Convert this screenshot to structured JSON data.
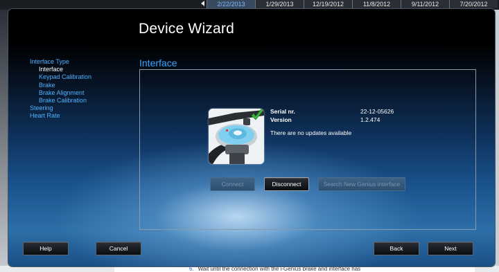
{
  "background": {
    "date_tabs": [
      "2/22/2013",
      "1/29/2013",
      "12/19/2012",
      "11/8/2012",
      "9/11/2012",
      "7/20/2012"
    ],
    "doc_bullet": "6.",
    "doc_text": "Wait until the connection with the i-Genius brake and interface has"
  },
  "dialog": {
    "title": "Device Wizard",
    "nav": [
      {
        "label": "Interface Type",
        "level": 0,
        "active": false
      },
      {
        "label": "Interface",
        "level": 1,
        "active": true
      },
      {
        "label": "Keypad Calibration",
        "level": 1,
        "active": false
      },
      {
        "label": "Brake",
        "level": 1,
        "active": false
      },
      {
        "label": "Brake Alignment",
        "level": 1,
        "active": false
      },
      {
        "label": "Brake Calibration",
        "level": 1,
        "active": false
      },
      {
        "label": "Steering",
        "level": 0,
        "active": false
      },
      {
        "label": "Heart Rate",
        "level": 0,
        "active": false
      }
    ],
    "section_title": "Interface",
    "device": {
      "serial_label": "Serial nr.",
      "serial_value": "22-12-05626",
      "version_label": "Version",
      "version_value": "1.2.474",
      "update_message": "There are no updates available",
      "status_icon": "green-checkmark-icon"
    },
    "actions": {
      "connect": "Connect",
      "disconnect": "Disconnect",
      "search": "Search New Genius interface"
    },
    "footer": {
      "help": "Help",
      "cancel": "Cancel",
      "back": "Back",
      "next": "Next"
    }
  },
  "colors": {
    "accent_blue": "#3aa5ff",
    "nav_link": "#4fb2ff",
    "check_green": "#3cb43c"
  }
}
